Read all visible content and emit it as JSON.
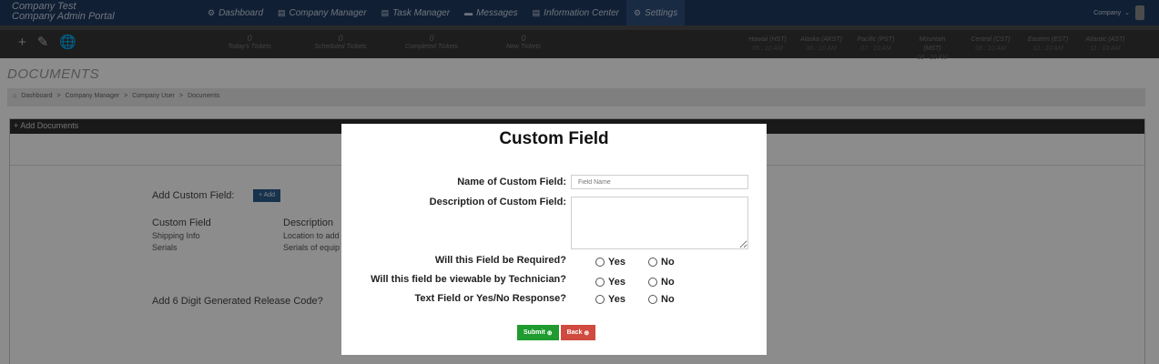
{
  "brand": {
    "line1": "Company Test",
    "line2": "Company Admin Portal"
  },
  "nav": [
    {
      "icon": "⚙",
      "label": "Dashboard"
    },
    {
      "icon": "▤",
      "label": "Company Manager"
    },
    {
      "icon": "▤",
      "label": "Task Manager"
    },
    {
      "icon": "▬",
      "label": "Messages"
    },
    {
      "icon": "▤",
      "label": "Information Center"
    },
    {
      "icon": "⚙",
      "label": "Settings"
    }
  ],
  "account": {
    "label": "Company",
    "chevron": "⌄"
  },
  "quick_actions": [
    "+",
    "✎",
    "🌐"
  ],
  "stats": [
    {
      "value": "0",
      "label": "Today's Tickets"
    },
    {
      "value": "0",
      "label": "Scheduled Tickets"
    },
    {
      "value": "0",
      "label": "Completed Tickets"
    },
    {
      "value": "0",
      "label": "New Tickets"
    }
  ],
  "timezones": [
    {
      "name": "Hawaii (HST)",
      "time": "05 : 10 AM"
    },
    {
      "name": "Alaska (AKST)",
      "time": "06 : 10 AM"
    },
    {
      "name": "Pacific (PST)",
      "time": "07 : 10 AM"
    },
    {
      "name": "Mountain (MST)",
      "time": "08 : 10 AM"
    },
    {
      "name": "Central (CST)",
      "time": "09 : 10 AM"
    },
    {
      "name": "Eastern (EST)",
      "time": "10 : 10 AM"
    },
    {
      "name": "Atlantic (AST)",
      "time": "11 : 10 AM"
    }
  ],
  "page": {
    "title": "DOCUMENTS",
    "breadcrumb": [
      "Dashboard",
      ">",
      "Company Manager",
      ">",
      "Company User",
      ">",
      "Documents"
    ],
    "panel_heading": "+ Add Documents",
    "add_custom_field_label": "Add Custom Field:",
    "add_button": "+ Add",
    "table": {
      "headers": [
        "Custom Field",
        "Description"
      ],
      "rows": [
        [
          "Shipping Info",
          "Location to add"
        ],
        [
          "Serials",
          "Serials of equip"
        ]
      ]
    },
    "release_code_label": "Add 6 Digit Generated Release Code?"
  },
  "modal": {
    "title": "Custom Field",
    "name_label": "Name of Custom Field:",
    "name_placeholder": "Field Name",
    "name_value": "",
    "description_label": "Description of Custom Field:",
    "description_value": "",
    "questions": [
      {
        "label": "Will this Field be Required?",
        "yes": "Yes",
        "no": "No"
      },
      {
        "label": "Will this field be viewable by Technician?",
        "yes": "Yes",
        "no": "No"
      },
      {
        "label": "Text Field or Yes/No Response?",
        "yes": "Yes",
        "no": "No"
      }
    ],
    "submit_label": "Submit",
    "back_label": "Back",
    "button_icon": "⊕"
  },
  "colors": {
    "nav_bg": "#1f3a5f",
    "submit": "#1f9b2f",
    "back": "#d04a3f",
    "add_button": "#2c5d8f"
  }
}
